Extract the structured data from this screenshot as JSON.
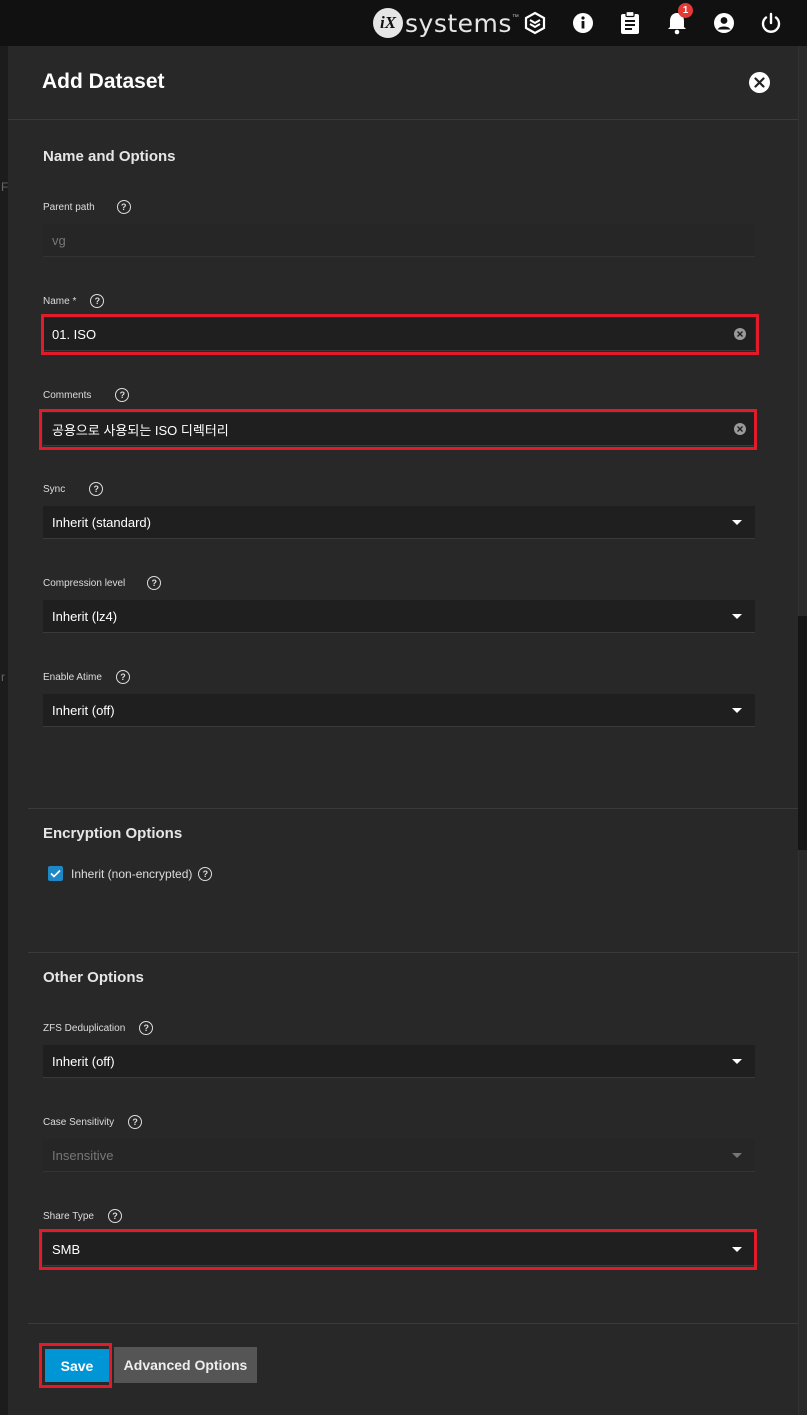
{
  "topbar": {
    "logo_mark": "iX",
    "logo_text": "systems",
    "logo_tm": "™",
    "notification_count": "1"
  },
  "panel": {
    "title": "Add Dataset"
  },
  "sections": {
    "name_options": "Name and Options",
    "encryption": "Encryption Options",
    "other": "Other Options"
  },
  "fields": {
    "parent_path": {
      "label": "Parent path",
      "value": "vg"
    },
    "name": {
      "label": "Name *",
      "value": "01. ISO"
    },
    "comments": {
      "label": "Comments",
      "value": "공용으로 사용되는 ISO 디렉터리"
    },
    "sync": {
      "label": "Sync",
      "value": "Inherit (standard)"
    },
    "compression": {
      "label": "Compression level",
      "value": "Inherit (lz4)"
    },
    "atime": {
      "label": "Enable Atime",
      "value": "Inherit (off)"
    },
    "encryption_inherit": {
      "label": "Inherit (non-encrypted)",
      "checked": true
    },
    "dedup": {
      "label": "ZFS Deduplication",
      "value": "Inherit (off)"
    },
    "case": {
      "label": "Case Sensitivity",
      "value": "Insensitive"
    },
    "share_type": {
      "label": "Share Type",
      "value": "SMB"
    }
  },
  "buttons": {
    "save": "Save",
    "advanced": "Advanced Options"
  },
  "icons": {
    "truecommand": "truecommand-icon",
    "info": "info-icon",
    "tasks": "clipboard-icon",
    "notifications": "bell-icon",
    "account": "account-icon",
    "power": "power-icon",
    "help": "help-icon",
    "close": "close-icon"
  },
  "colors": {
    "accent": "#0095d5",
    "highlight": "#e21b2a",
    "panel_bg": "#282828",
    "badge": "#e53935"
  }
}
